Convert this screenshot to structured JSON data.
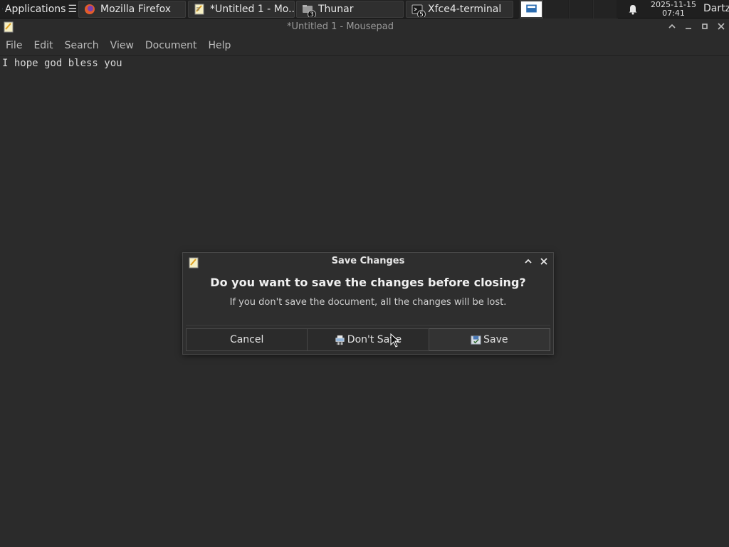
{
  "taskbar": {
    "apps_label": "Applications",
    "tasks": [
      {
        "label": "Mozilla Firefox",
        "icon": "firefox-icon"
      },
      {
        "label": "*Untitled 1 - Mo...",
        "icon": "mousepad-icon"
      },
      {
        "label": "Thunar",
        "icon": "thunar-icon",
        "badge": "3"
      },
      {
        "label": "Xfce4-terminal",
        "icon": "terminal-icon",
        "badge": "5"
      }
    ],
    "clock": {
      "date": "2025-11-15",
      "time": "07:41"
    },
    "user": "Dartz"
  },
  "window": {
    "title": "*Untitled 1 - Mousepad",
    "menu": [
      "File",
      "Edit",
      "Search",
      "View",
      "Document",
      "Help"
    ]
  },
  "editor": {
    "text": "I hope god bless you"
  },
  "dialog": {
    "title": "Save Changes",
    "heading": "Do you want to save the changes before closing?",
    "message": "If you don't save the document, all the changes will be lost.",
    "buttons": {
      "cancel": "Cancel",
      "dont_save": "Don't Save",
      "save": "Save"
    }
  },
  "colors": {
    "background": "#2b2b2b",
    "taskbar": "#1f1f1f",
    "dialog": "#2e2e2e"
  }
}
